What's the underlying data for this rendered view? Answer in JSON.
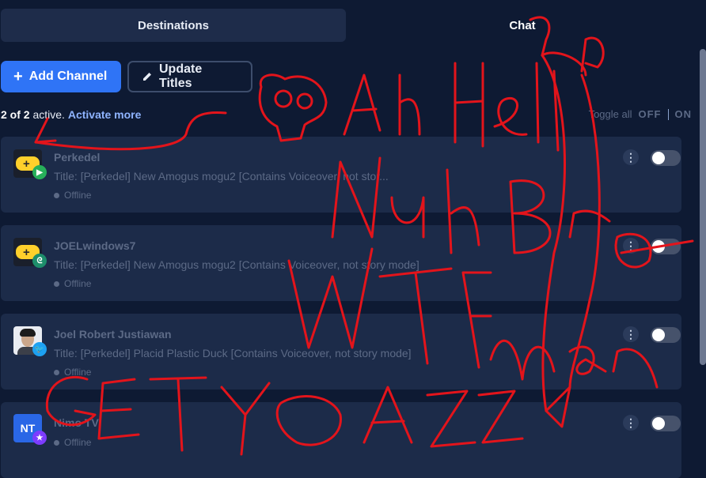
{
  "tabs": {
    "destinations": "Destinations",
    "chat": "Chat"
  },
  "toolbar": {
    "add_channel": "Add Channel",
    "update_titles": "Update Titles"
  },
  "summary": {
    "count": "2 of 2",
    "active_text": " active.",
    "activate_more": "Activate more"
  },
  "toggle_all": {
    "label": "Toggle all",
    "off": "OFF",
    "on": "ON"
  },
  "channels": [
    {
      "name": "Perkedel",
      "title": "Title: [Perkedel] New Amogus mogu2 [Contains Voiceover, not stor...",
      "status": "Offline",
      "platform_icon": "kick-icon",
      "badge_icon": "play-badge-icon"
    },
    {
      "name": "JOELwindows7",
      "title": "Title: [Perkedel] New Amogus mogu2 [Contains Voiceover, not story mode]",
      "status": "Offline",
      "platform_icon": "kick-icon",
      "badge_icon": "dragon-badge-icon"
    },
    {
      "name": "Joel Robert Justiawan",
      "title": "Title: [Perkedel] Placid Plastic Duck [Contains Voiceover, not story mode]",
      "status": "Offline",
      "platform_icon": "avatar",
      "badge_icon": "twitter-badge-icon"
    },
    {
      "name": "Nimo TV",
      "title": "",
      "status": "Offline",
      "platform_icon": "nt-logo",
      "logo_text": "NT",
      "badge_icon": "nimo-badge-icon"
    }
  ],
  "colors": {
    "accent": "#2f74f6",
    "background": "#0e1a33",
    "card": "#1c2b49",
    "scribble": "#e3141b"
  }
}
